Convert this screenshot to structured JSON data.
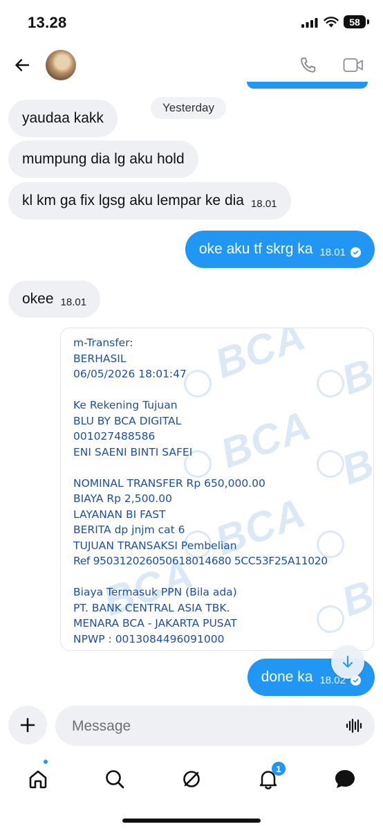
{
  "status_bar": {
    "time": "13.28",
    "battery": "58"
  },
  "header": {
    "avatar": "contact-avatar"
  },
  "day_label": "Yesterday",
  "messages": [
    {
      "dir": "in",
      "text": "yaudaa kakk",
      "time": ""
    },
    {
      "dir": "in",
      "text": "mumpung dia lg aku hold",
      "time": ""
    },
    {
      "dir": "in",
      "text": "kl km ga fix lgsg aku lempar ke dia",
      "time": "18.01"
    },
    {
      "dir": "out",
      "text": "oke aku tf skrg ka",
      "time": "18.01",
      "status": "read-check-icon"
    },
    {
      "dir": "in",
      "text": "okee",
      "time": "18.01"
    },
    {
      "dir": "out",
      "text": "done ka",
      "time": "18.02",
      "status": "read-check-icon"
    }
  ],
  "receipt": {
    "watermark": "BCA",
    "lines": [
      "m-Transfer:",
      "BERHASIL",
      "06/05/2026 18:01:47",
      "",
      "Ke Rekening Tujuan",
      "BLU BY BCA DIGITAL",
      "001027488586",
      "ENI SAENI BINTI SAFEI",
      "",
      "NOMINAL TRANSFER Rp 650,000.00",
      "BIAYA Rp 2,500.00",
      "LAYANAN BI FAST",
      "BERITA dp jnjm cat 6",
      "TUJUAN TRANSAKSI Pembelian",
      "Ref 950312026050618014680 5CC53F25A11020",
      "",
      "Biaya Termasuk PPN (Bila ada)",
      "PT. BANK CENTRAL ASIA TBK.",
      "MENARA BCA - JAKARTA PUSAT",
      "NPWP : 0013084496091000"
    ]
  },
  "composer": {
    "placeholder": "Message",
    "value": ""
  },
  "tabbar": {
    "notification_count": "1"
  },
  "colors": {
    "accent": "#2196f3",
    "incoming_bubble": "#eff0f3",
    "receipt_text": "#1c4fa0"
  }
}
